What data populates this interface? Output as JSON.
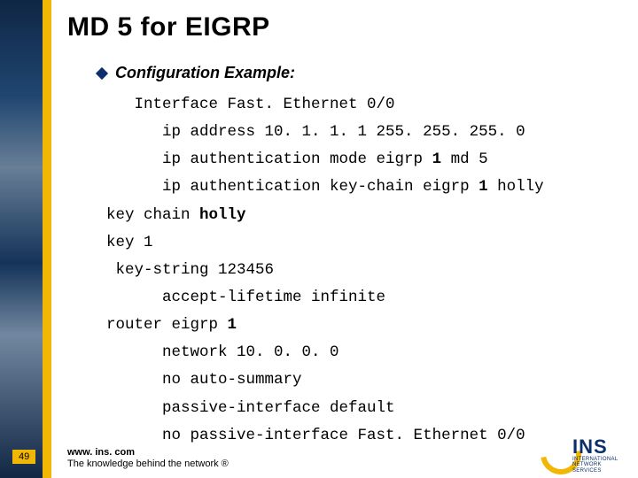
{
  "title": "MD 5 for EIGRP",
  "bullet_heading": "Configuration Example:",
  "code_lines": [
    {
      "indent": 1,
      "segments": [
        {
          "t": "Interface Fast. Ethernet 0/0"
        }
      ]
    },
    {
      "indent": 2,
      "segments": [
        {
          "t": "ip address 10. 1. 1. 1 255. 255. 255. 0"
        }
      ]
    },
    {
      "indent": 2,
      "segments": [
        {
          "t": "ip authentication mode eigrp "
        },
        {
          "t": "1",
          "bold": true
        },
        {
          "t": " md 5"
        }
      ]
    },
    {
      "indent": 2,
      "segments": [
        {
          "t": "ip authentication key-chain eigrp "
        },
        {
          "t": "1",
          "bold": true
        },
        {
          "t": " holly"
        }
      ]
    },
    {
      "indent": 0,
      "segments": [
        {
          "t": "key chain "
        },
        {
          "t": "holly",
          "bold": true
        }
      ]
    },
    {
      "indent": 0,
      "segments": [
        {
          "t": "key 1"
        }
      ]
    },
    {
      "indent": 0,
      "segments": [
        {
          "t": " key-string 123456"
        }
      ]
    },
    {
      "indent": 2,
      "segments": [
        {
          "t": "accept-lifetime infinite"
        }
      ]
    },
    {
      "indent": 0,
      "segments": [
        {
          "t": "router eigrp "
        },
        {
          "t": "1",
          "bold": true
        }
      ]
    },
    {
      "indent": 2,
      "segments": [
        {
          "t": "network 10. 0. 0. 0"
        }
      ]
    },
    {
      "indent": 2,
      "segments": [
        {
          "t": "no auto-summary"
        }
      ]
    },
    {
      "indent": 2,
      "segments": [
        {
          "t": "passive-interface default"
        }
      ]
    },
    {
      "indent": 2,
      "segments": [
        {
          "t": "no passive-interface Fast. Ethernet 0/0"
        }
      ]
    }
  ],
  "page_number": "49",
  "footer": {
    "url": "www. ins. com",
    "tagline": "The knowledge behind the network ®"
  },
  "logo": {
    "brand": "INS",
    "sub1": "INTERNATIONAL",
    "sub2": "NETWORK SERVICES"
  },
  "colors": {
    "accent_yellow": "#f2b705",
    "brand_blue": "#0a2f6b"
  }
}
